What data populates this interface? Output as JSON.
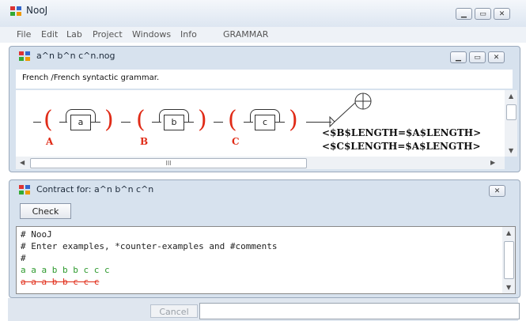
{
  "app": {
    "title": "NooJ",
    "icon": "nooj-grid-icon",
    "window_buttons": [
      "minimize",
      "maximize",
      "close"
    ]
  },
  "menu": {
    "items": [
      "File",
      "Edit",
      "Lab",
      "Project",
      "Windows",
      "Info",
      "GRAMMAR"
    ]
  },
  "grammar_window": {
    "title": "a^n b^n c^n.nog",
    "description": "French /French  syntactic grammar.",
    "graph": {
      "nodes": [
        "a",
        "b",
        "c"
      ],
      "variables": [
        "A",
        "B",
        "C"
      ],
      "open_paren": "(",
      "close_paren": ")",
      "constraints": [
        "<$B$LENGTH=$A$LENGTH>",
        "<$C$LENGTH=$A$LENGTH>"
      ]
    },
    "hscroll_grip": "III"
  },
  "contract_window": {
    "title": "Contract for: a^n b^n c^n",
    "check_label": "Check",
    "lines": [
      {
        "text": "# NooJ",
        "color": "#222222",
        "strike": false
      },
      {
        "text": "# Enter examples, *counter-examples and #comments",
        "color": "#222222",
        "strike": false
      },
      {
        "text": "#",
        "color": "#222222",
        "strike": false
      },
      {
        "text": "a a a b b b c c c",
        "color": "#2e9a2e",
        "strike": false
      },
      {
        "text": "a a a b b c c c",
        "color": "#e02b17",
        "strike": true
      }
    ]
  },
  "footer": {
    "cancel_label": "Cancel"
  },
  "colors": {
    "accent_red": "#e02b17",
    "accent_green": "#2e9a2e"
  }
}
